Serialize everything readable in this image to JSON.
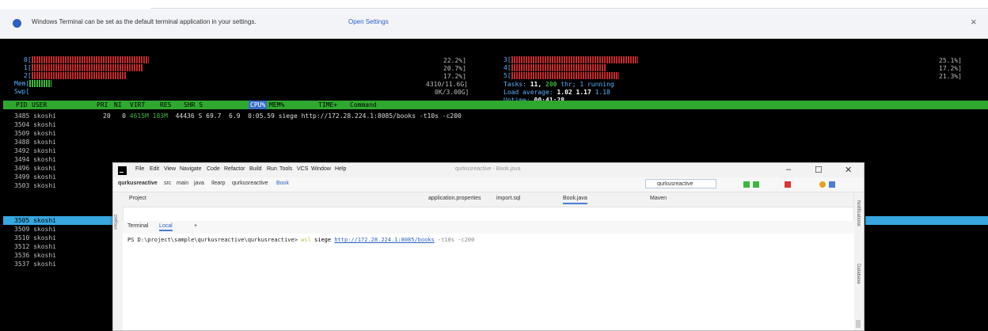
{
  "infobar": {
    "message": "Windows Terminal can be set as the default terminal application in your settings.",
    "link": "Open Settings",
    "close": "×"
  },
  "htop": {
    "cpu_left": [
      {
        "label": "0[",
        "pct": "22.2%]",
        "level": 0.75
      },
      {
        "label": "1[",
        "pct": "20.7%]",
        "level": 0.7
      },
      {
        "label": "2[",
        "pct": "17.2%]",
        "level": 0.6
      }
    ],
    "cpu_right": [
      {
        "label": "3[",
        "pct": "25.1%]",
        "level": 0.8
      },
      {
        "label": "4[",
        "pct": "17.2%]",
        "level": 0.6
      },
      {
        "label": "5[",
        "pct": "21.3%]",
        "level": 0.7
      }
    ],
    "mem": {
      "label": "Mem[",
      "value": "4310/11.6G]"
    },
    "swp": {
      "label": "Swp[",
      "value": "0K/3.00G]"
    },
    "tasks": {
      "prefix": "Tasks: ",
      "count": "11,",
      "thr": "200",
      "suffix": " thr; 1 running"
    },
    "load": {
      "prefix": "Load average: ",
      "l1": "1.02",
      "l5": "1.17",
      "l15": "1.18"
    },
    "uptime": {
      "prefix": "Uptime: ",
      "value": "00:41:28"
    },
    "header": {
      "pid": "PID",
      "user": "USER",
      "pri": "PRI",
      "ni": "NI",
      "virt": "VIRT",
      "res": "RES",
      "shr": "SHR S",
      "cpu": "CPU%",
      "mem": "MEM%",
      "time": "TIME+",
      "command": "Command"
    },
    "first_row": {
      "pri": "20",
      "ni": "0",
      "virt": "4615M",
      "res": "183M",
      "shr": "44436 S",
      "cpu": "69.7",
      "mem": "6.9",
      "time": "0:05.59",
      "command": "siege http://172.28.224.1:8085/books -t10s -c200"
    },
    "processes": [
      {
        "pid": "3485",
        "user": "skoshi"
      },
      {
        "pid": "3504",
        "user": "skoshi"
      },
      {
        "pid": "3509",
        "user": "skoshi"
      },
      {
        "pid": "3488",
        "user": "skoshi"
      },
      {
        "pid": "3492",
        "user": "skoshi"
      },
      {
        "pid": "3494",
        "user": "skoshi"
      },
      {
        "pid": "3496",
        "user": "skoshi"
      },
      {
        "pid": "3499",
        "user": "skoshi"
      },
      {
        "pid": "3503",
        "user": "skoshi"
      },
      {
        "pid": "3505",
        "user": "skoshi"
      },
      {
        "pid": "3509",
        "user": "skoshi"
      },
      {
        "pid": "3510",
        "user": "skoshi"
      },
      {
        "pid": "3512",
        "user": "skoshi"
      },
      {
        "pid": "3536",
        "user": "skoshi"
      },
      {
        "pid": "3537",
        "user": "skoshi"
      }
    ]
  },
  "ide": {
    "menu": [
      "File",
      "Edit",
      "View",
      "Navigate",
      "Code",
      "Refactor",
      "Build",
      "Run",
      "Tools",
      "VCS",
      "Window",
      "Help"
    ],
    "window_title": "qurkusreactive - Book.java",
    "breadcrumb": [
      "qurkusreactive",
      "src",
      "main",
      "java",
      "Ilearp",
      "qurkusreactive",
      "Book"
    ],
    "run_config": "qurkusreactive",
    "project_label": "Project",
    "file_tabs": [
      "application.properties",
      "import.sql",
      "Book.java",
      "Maven"
    ],
    "terminal_tab": "Terminal",
    "local_tab": "Local",
    "add_tab": "+",
    "side_right": [
      "Notifications",
      "Database"
    ],
    "prompt": {
      "path": "PS D:\\project\\sample\\qurkusreactive\\qurkusreactive>",
      "kw": "wsl",
      "cmd": "siege",
      "url": "http://172.28.224.1:8085/books",
      "args": "-t10s -c200"
    }
  }
}
